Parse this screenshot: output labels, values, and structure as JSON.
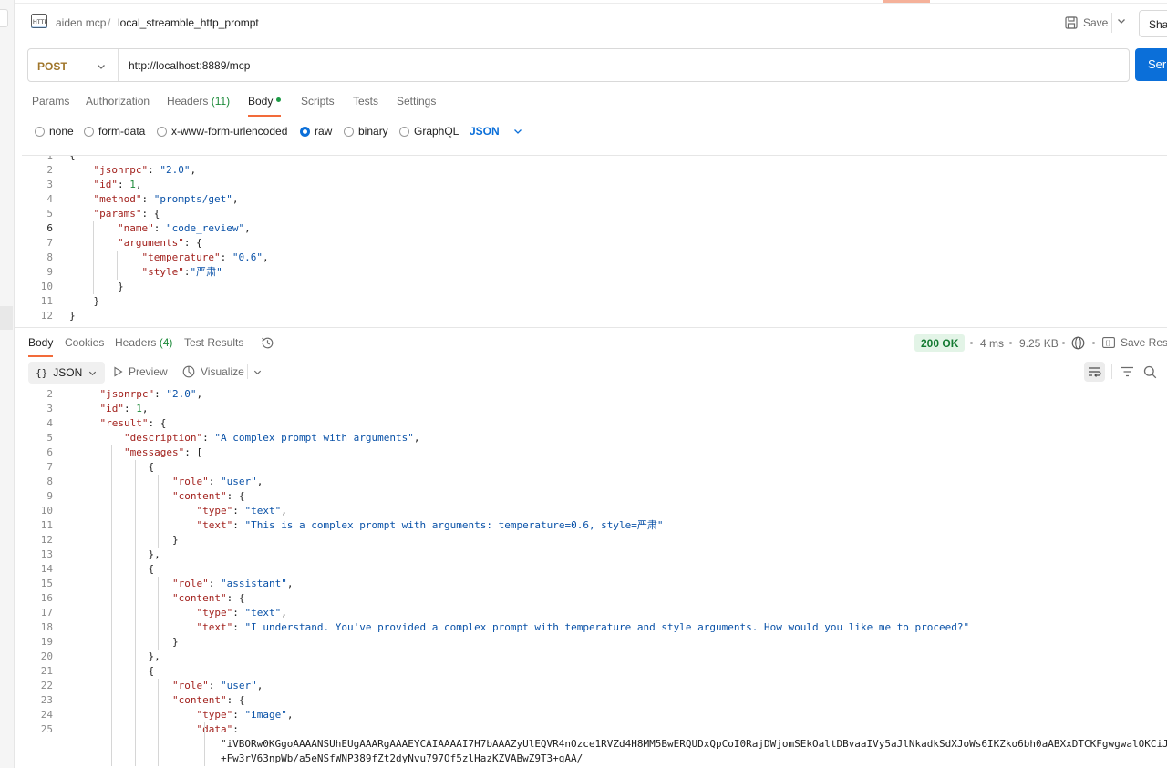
{
  "header": {
    "breadcrumb_parent": "aiden mcp",
    "breadcrumb_sep": "/",
    "breadcrumb_current": "local_streamble_http_prompt",
    "save_label": "Save",
    "share_label": "Sha"
  },
  "request": {
    "method": "POST",
    "url": "http://localhost:8889/mcp",
    "send_label": "Ser"
  },
  "request_tabs": {
    "params": "Params",
    "authorization": "Authorization",
    "headers": "Headers",
    "headers_count": "(11)",
    "body": "Body",
    "scripts": "Scripts",
    "tests": "Tests",
    "settings": "Settings",
    "active": "Body"
  },
  "body_types": {
    "none": "none",
    "form_data": "form-data",
    "urlencoded": "x-www-form-urlencoded",
    "raw": "raw",
    "binary": "binary",
    "graphql": "GraphQL",
    "selected": "raw",
    "language": "JSON"
  },
  "request_body_lines": [
    {
      "n": "1",
      "t": "{"
    },
    {
      "n": "2",
      "t": "    \"jsonrpc\": \"2.0\","
    },
    {
      "n": "3",
      "t": "    \"id\": 1,"
    },
    {
      "n": "4",
      "t": "    \"method\": \"prompts/get\","
    },
    {
      "n": "5",
      "t": "    \"params\": {"
    },
    {
      "n": "6",
      "t": "        \"name\": \"code_review\","
    },
    {
      "n": "7",
      "t": "        \"arguments\": {"
    },
    {
      "n": "8",
      "t": "            \"temperature\": \"0.6\","
    },
    {
      "n": "9",
      "t": "            \"style\":\"严肃\""
    },
    {
      "n": "10",
      "t": "        }"
    },
    {
      "n": "11",
      "t": "    }"
    },
    {
      "n": "12",
      "t": "}"
    }
  ],
  "response_tabs": {
    "body": "Body",
    "cookies": "Cookies",
    "headers": "Headers",
    "headers_count": "(4)",
    "test_results": "Test Results",
    "active": "Body"
  },
  "response_meta": {
    "status": "200 OK",
    "time": "4 ms",
    "size": "9.25 KB",
    "save_response": "Save Resp"
  },
  "response_toolbar": {
    "format_braces": "{}",
    "format": "JSON",
    "preview": "Preview",
    "visualize": "Visualize"
  },
  "response_body_lines": [
    {
      "n": "2",
      "t": "    \"jsonrpc\": \"2.0\","
    },
    {
      "n": "3",
      "t": "    \"id\": 1,"
    },
    {
      "n": "4",
      "t": "    \"result\": {"
    },
    {
      "n": "5",
      "t": "        \"description\": \"A complex prompt with arguments\","
    },
    {
      "n": "6",
      "t": "        \"messages\": ["
    },
    {
      "n": "7",
      "t": "            {"
    },
    {
      "n": "8",
      "t": "                \"role\": \"user\","
    },
    {
      "n": "9",
      "t": "                \"content\": {"
    },
    {
      "n": "10",
      "t": "                    \"type\": \"text\","
    },
    {
      "n": "11",
      "t": "                    \"text\": \"This is a complex prompt with arguments: temperature=0.6, style=严肃\""
    },
    {
      "n": "12",
      "t": "                }"
    },
    {
      "n": "13",
      "t": "            },"
    },
    {
      "n": "14",
      "t": "            {"
    },
    {
      "n": "15",
      "t": "                \"role\": \"assistant\","
    },
    {
      "n": "16",
      "t": "                \"content\": {"
    },
    {
      "n": "17",
      "t": "                    \"type\": \"text\","
    },
    {
      "n": "18",
      "t": "                    \"text\": \"I understand. You've provided a complex prompt with temperature and style arguments. How would you like me to proceed?\""
    },
    {
      "n": "19",
      "t": "                }"
    },
    {
      "n": "20",
      "t": "            },"
    },
    {
      "n": "21",
      "t": "            {"
    },
    {
      "n": "22",
      "t": "                \"role\": \"user\","
    },
    {
      "n": "23",
      "t": "                \"content\": {"
    },
    {
      "n": "24",
      "t": "                    \"type\": \"image\","
    },
    {
      "n": "25",
      "t": "                    \"data\":"
    },
    {
      "n": "",
      "t": "                        \"iVBORw0KGgoAAAANSUhEUgAAARgAAAEYCAIAAAAI7H7bAAAZyUlEQVR4nOzce1RVZd4H8MM5BwERQUDxQpCoI0RajDWjomSEkOaltDBvaaIVy5aJlNkadkSdXJoWs6IKZko6bh0aABXxDTCKFgwgwalOKCiJiJeYEy"
    },
    {
      "n": "",
      "t": "                        +Fw3rV63npWb/a5eNSfWNP389fZt2dyNvu797Of5zlHazKZVABwZ9T3+gAA/"
    }
  ],
  "colors": {
    "accent": "#f26b3a",
    "primary": "#0b6fd9",
    "json_key": "#a3231f",
    "json_string": "#0a52a8",
    "json_number": "#1d8a3a",
    "status_ok_bg": "#e3f4e7",
    "status_ok_text": "#137a31",
    "method": "#a0762b"
  },
  "icons": {
    "collection": "http-icon",
    "save": "save-icon",
    "history": "history-icon",
    "globe": "globe-icon",
    "save_response": "save-response-icon",
    "wrap": "wrap-lines-icon",
    "filter": "filter-icon",
    "search": "search-icon"
  }
}
